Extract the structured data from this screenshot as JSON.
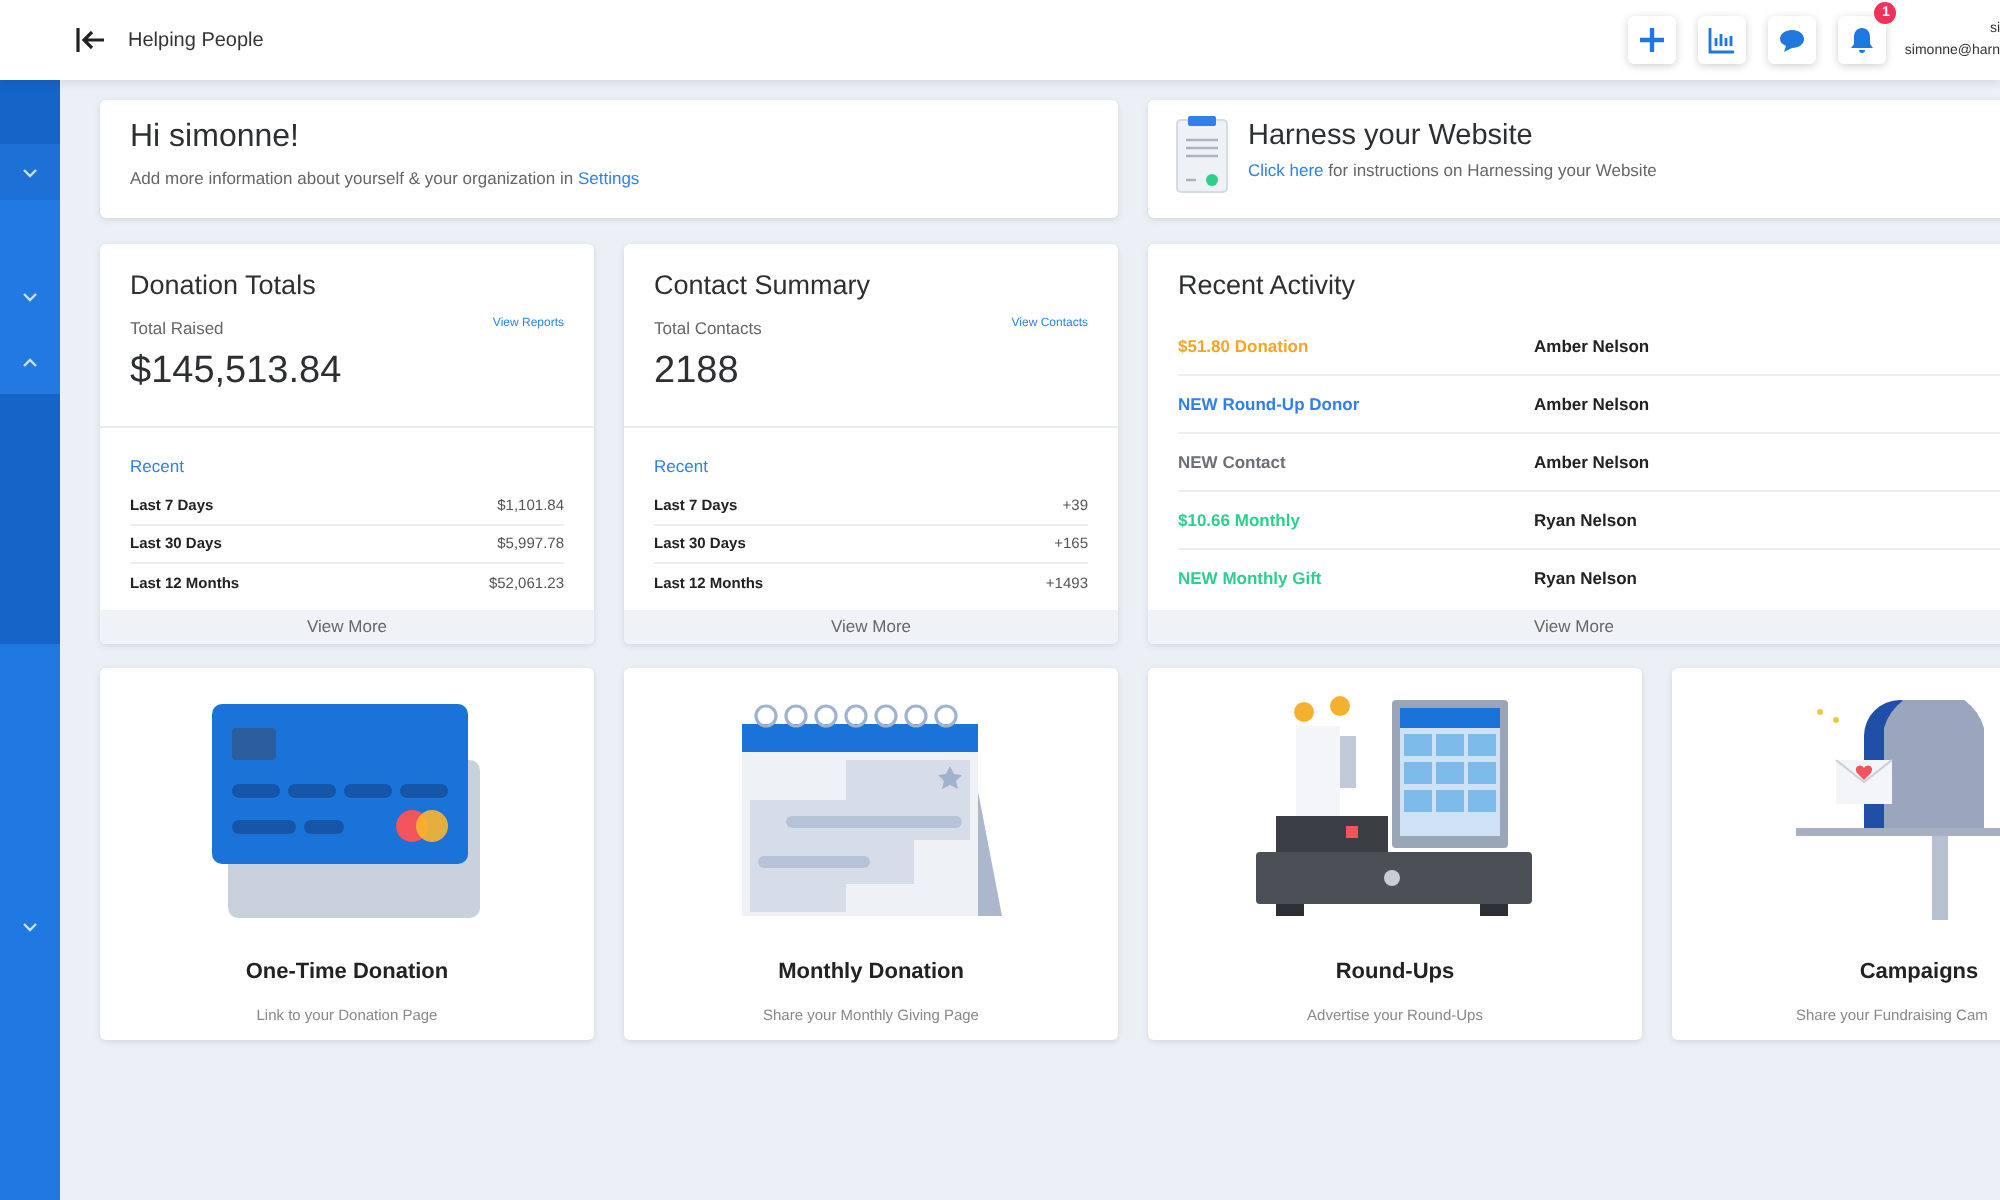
{
  "header": {
    "title": "Helping People",
    "notifications": {
      "badge": "1"
    },
    "user": {
      "name": "si",
      "email": "simonne@harn"
    }
  },
  "sidebar": {
    "items": [
      {
        "expanded": false
      },
      {
        "expanded": false
      },
      {
        "expanded": true
      },
      {
        "expanded": false
      }
    ]
  },
  "welcome": {
    "title": "Hi simonne!",
    "text": "Add more information about yourself & your organization in",
    "link": "Settings"
  },
  "harness": {
    "title": "Harness your Website",
    "link": "Click here",
    "text": "for instructions on Harnessing your Website"
  },
  "donation_totals": {
    "title": "Donation Totals",
    "label": "Total Raised",
    "link": "View Reports",
    "value": "$145,513.84",
    "recent": "Recent",
    "rows": [
      {
        "label": "Last 7 Days",
        "value": "$1,101.84"
      },
      {
        "label": "Last 30 Days",
        "value": "$5,997.78"
      },
      {
        "label": "Last 12 Months",
        "value": "$52,061.23"
      }
    ],
    "footer": "View More"
  },
  "contact_summary": {
    "title": "Contact Summary",
    "label": "Total Contacts",
    "link": "View Contacts",
    "value": "2188",
    "recent": "Recent",
    "rows": [
      {
        "label": "Last 7 Days",
        "value": "+39"
      },
      {
        "label": "Last 30 Days",
        "value": "+165"
      },
      {
        "label": "Last 12 Months",
        "value": "+1493"
      }
    ],
    "footer": "View More"
  },
  "recent_activity": {
    "title": "Recent Activity",
    "rows": [
      {
        "event": "$51.80 Donation",
        "color": "#f5a623",
        "name": "Amber Nelson"
      },
      {
        "event": "NEW Round-Up Donor",
        "color": "#2f80ed",
        "name": "Amber Nelson"
      },
      {
        "event": "NEW Contact",
        "color": "#6b6f76",
        "name": "Amber Nelson"
      },
      {
        "event": "$10.66 Monthly",
        "color": "#2ecf8e",
        "name": "Ryan Nelson"
      },
      {
        "event": "NEW Monthly Gift",
        "color": "#2ecf8e",
        "name": "Ryan Nelson"
      }
    ],
    "footer": "View More"
  },
  "tiles": [
    {
      "kind": "card",
      "title": "One-Time Donation",
      "subtitle": "Link to your Donation Page"
    },
    {
      "kind": "calendar",
      "title": "Monthly Donation",
      "subtitle": "Share your Monthly Giving Page"
    },
    {
      "kind": "register",
      "title": "Round-Ups",
      "subtitle": "Advertise your Round-Ups"
    },
    {
      "kind": "mailbox",
      "title": "Campaigns",
      "subtitle": "Share your Fundraising Cam"
    }
  ]
}
